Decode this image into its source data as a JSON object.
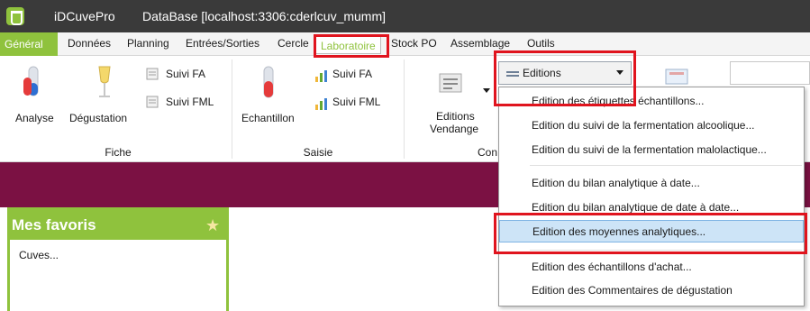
{
  "window": {
    "app_name": "iDCuvePro",
    "database": "DataBase [localhost:3306:cderlcuv_mumm]"
  },
  "menubar": {
    "tabs": [
      {
        "label": "Général"
      },
      {
        "label": "Données"
      },
      {
        "label": "Planning"
      },
      {
        "label": "Entrées/Sorties"
      },
      {
        "label": "Cercle"
      },
      {
        "label": "Laboratoire"
      },
      {
        "label": "Stock PO"
      },
      {
        "label": "Assemblage"
      },
      {
        "label": "Outils"
      }
    ]
  },
  "ribbon": {
    "fiche": {
      "group_label": "Fiche",
      "analyse": "Analyse",
      "degustation": "Dégustation",
      "suivi_fa": "Suivi FA",
      "suivi_fml": "Suivi FML"
    },
    "saisie": {
      "group_label": "Saisie",
      "echantillon": "Echantillon",
      "suivi_fa": "Suivi FA",
      "suivi_fml": "Suivi FML"
    },
    "consult": {
      "group_label": "Con",
      "editions_vendange_1": "Editions",
      "editions_vendange_2": "Vendange"
    }
  },
  "editions_dropdown": {
    "button_label": "Editions",
    "items": [
      {
        "label": "Edition des étiquettes échantillons..."
      },
      {
        "label": "Edition du suivi de la fermentation alcoolique..."
      },
      {
        "label": "Edition du suivi de la fermentation malolactique..."
      },
      {
        "label": "Edition du bilan analytique à date..."
      },
      {
        "label": "Edition du bilan analytique de date à date..."
      },
      {
        "label": "Edition des moyennes analytiques..."
      },
      {
        "label": "Edition des échantillons d'achat..."
      },
      {
        "label": "Edition des Commentaires de dégustation"
      }
    ]
  },
  "favorites": {
    "title": "Mes favoris",
    "items": [
      {
        "label": "Cuves..."
      }
    ]
  },
  "colors": {
    "accent_green": "#8fc23d",
    "band_maroon": "#7b1143",
    "highlight_red": "#e0141e",
    "hover_blue": "#cde4f7"
  }
}
